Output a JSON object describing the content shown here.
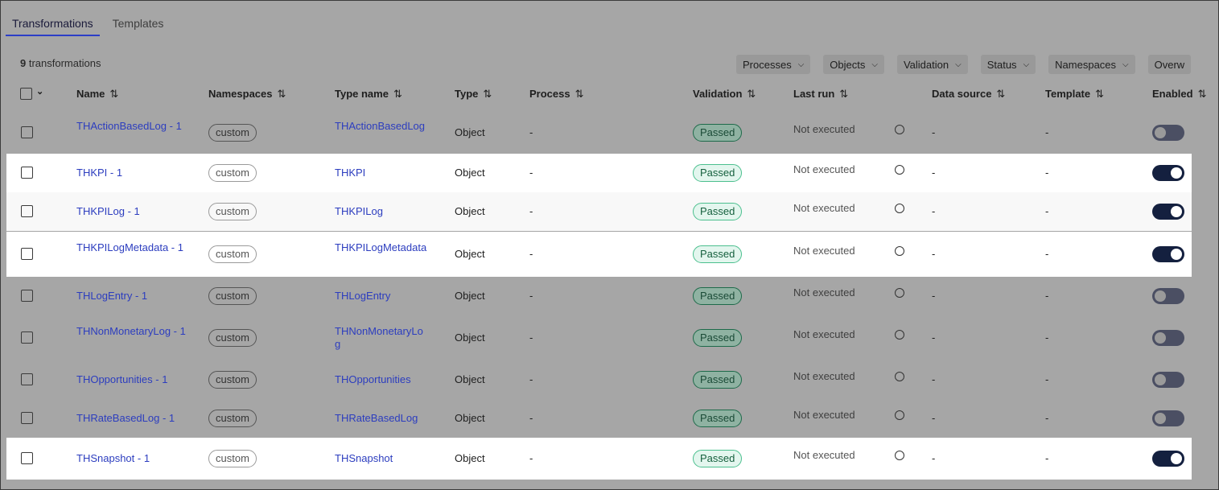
{
  "tabs": [
    "Transformations",
    "Templates"
  ],
  "count": {
    "number": "9",
    "label": "transformations"
  },
  "filters": [
    "Processes",
    "Objects",
    "Validation",
    "Status",
    "Namespaces",
    "Overw"
  ],
  "columns": {
    "name": "Name",
    "namespaces": "Namespaces",
    "type_name": "Type name",
    "type": "Type",
    "process": "Process",
    "validation": "Validation",
    "last_run": "Last run",
    "data_source": "Data source",
    "template": "Template",
    "enabled": "Enabled",
    "sort_icon": "⇅"
  },
  "rows": [
    {
      "name": "THActionBasedLog - 1",
      "namespace": "custom",
      "type_name": "THActionBasedLog",
      "type": "Object",
      "process": "-",
      "validation": "Passed",
      "last_run": "Not executed",
      "data_source": "-",
      "template": "-",
      "enabled": false,
      "highlighted": false
    },
    {
      "name": "THKPI - 1",
      "namespace": "custom",
      "type_name": "THKPI",
      "type": "Object",
      "process": "-",
      "validation": "Passed",
      "last_run": "Not executed",
      "data_source": "-",
      "template": "-",
      "enabled": true,
      "highlighted": true
    },
    {
      "name": "THKPILog - 1",
      "namespace": "custom",
      "type_name": "THKPILog",
      "type": "Object",
      "process": "-",
      "validation": "Passed",
      "last_run": "Not executed",
      "data_source": "-",
      "template": "-",
      "enabled": true,
      "highlighted": true
    },
    {
      "name": "THKPILogMetadata - 1",
      "namespace": "custom",
      "type_name": "THKPILogMetadata",
      "type": "Object",
      "process": "-",
      "validation": "Passed",
      "last_run": "Not executed",
      "data_source": "-",
      "template": "-",
      "enabled": true,
      "highlighted": true
    },
    {
      "name": "THLogEntry - 1",
      "namespace": "custom",
      "type_name": "THLogEntry",
      "type": "Object",
      "process": "-",
      "validation": "Passed",
      "last_run": "Not executed",
      "data_source": "-",
      "template": "-",
      "enabled": false,
      "highlighted": false
    },
    {
      "name": "THNonMonetaryLog - 1",
      "namespace": "custom",
      "type_name": "THNonMonetaryLog",
      "type": "Object",
      "process": "-",
      "validation": "Passed",
      "last_run": "Not executed",
      "data_source": "-",
      "template": "-",
      "enabled": false,
      "highlighted": false
    },
    {
      "name": "THOpportunities - 1",
      "namespace": "custom",
      "type_name": "THOpportunities",
      "type": "Object",
      "process": "-",
      "validation": "Passed",
      "last_run": "Not executed",
      "data_source": "-",
      "template": "-",
      "enabled": false,
      "highlighted": false
    },
    {
      "name": "THRateBasedLog - 1",
      "namespace": "custom",
      "type_name": "THRateBasedLog",
      "type": "Object",
      "process": "-",
      "validation": "Passed",
      "last_run": "Not executed",
      "data_source": "-",
      "template": "-",
      "enabled": false,
      "highlighted": false
    },
    {
      "name": "THSnapshot - 1",
      "namespace": "custom",
      "type_name": "THSnapshot",
      "type": "Object",
      "process": "-",
      "validation": "Passed",
      "last_run": "Not executed",
      "data_source": "-",
      "template": "-",
      "enabled": true,
      "highlighted": true
    }
  ]
}
